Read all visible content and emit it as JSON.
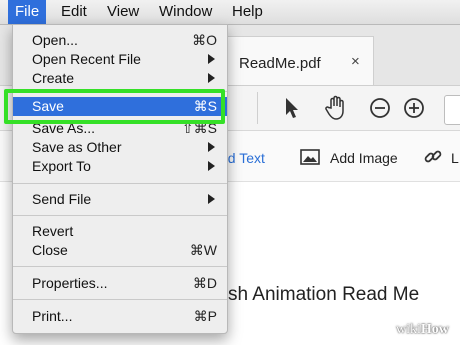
{
  "menubar": {
    "apple_icon": "apple-icon",
    "items": [
      "File",
      "Edit",
      "View",
      "Window",
      "Help"
    ]
  },
  "tab": {
    "title": "ReadMe.pdf",
    "close": "×"
  },
  "toolbar": {
    "add_text": "dd Text",
    "add_image": "Add Image",
    "link_cut": "L"
  },
  "document": {
    "text": "sh Animation Read Me"
  },
  "file_menu": {
    "items": [
      {
        "label": "Open...",
        "shortcut": "⌘O"
      },
      {
        "label": "Open Recent File",
        "submenu": true
      },
      {
        "label": "Create",
        "submenu": true
      },
      {
        "label": "Save",
        "shortcut": "⌘S",
        "selected": true
      },
      {
        "label": "Save As...",
        "shortcut": "⇧⌘S"
      },
      {
        "label": "Save as Other",
        "submenu": true
      },
      {
        "label": "Export To",
        "submenu": true
      },
      {
        "label": "Send File",
        "submenu": true
      },
      {
        "label": "Revert"
      },
      {
        "label": "Close",
        "shortcut": "⌘W"
      },
      {
        "label": "Properties...",
        "shortcut": "⌘D"
      },
      {
        "label": "Print...",
        "shortcut": "⌘P"
      }
    ]
  },
  "colors": {
    "selection": "#2f6fdc",
    "highlight_box": "#35e027",
    "link_blue": "#2a6fd6"
  },
  "watermark": {
    "prefix": "wiki",
    "suffix": "How"
  }
}
